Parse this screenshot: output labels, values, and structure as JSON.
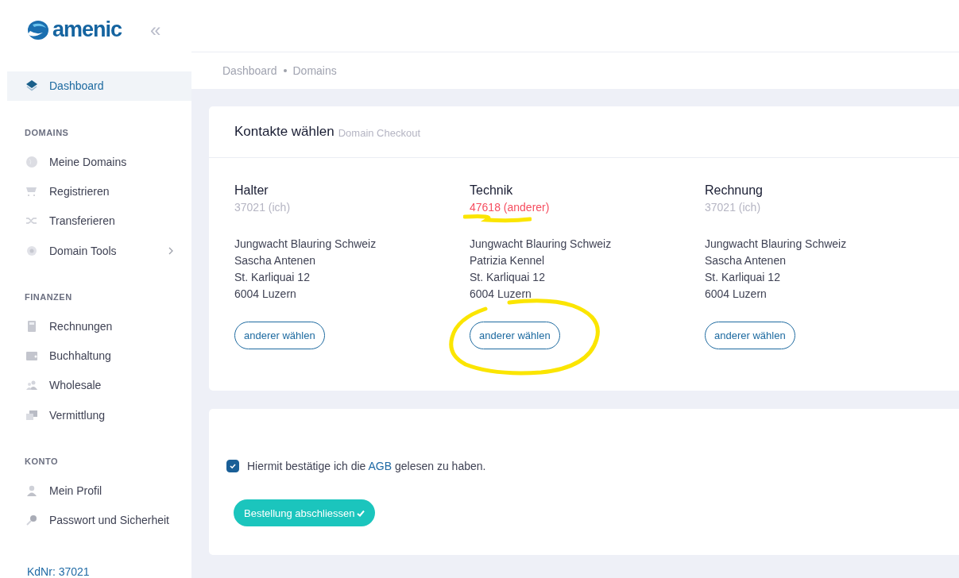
{
  "sidebar": {
    "brand": "amenic",
    "collapse_icon": "«",
    "items": [
      {
        "kind": "item",
        "label": "Dashboard",
        "selected": true
      },
      {
        "kind": "heading",
        "label": "DOMAINS"
      },
      {
        "kind": "item",
        "label": "Meine Domains",
        "selected": false
      },
      {
        "kind": "item",
        "label": "Registrieren",
        "selected": false
      },
      {
        "kind": "item",
        "label": "Transferieren",
        "selected": false
      },
      {
        "kind": "item",
        "label": "Domain Tools",
        "selected": false,
        "submenu": true
      },
      {
        "kind": "heading",
        "label": "FINANZEN"
      },
      {
        "kind": "item",
        "label": "Rechnungen",
        "selected": false
      },
      {
        "kind": "item",
        "label": "Buchhaltung",
        "selected": false
      },
      {
        "kind": "item",
        "label": "Wholesale",
        "selected": false
      },
      {
        "kind": "item",
        "label": "Vermittlung",
        "selected": false
      },
      {
        "kind": "heading",
        "label": "KONTO"
      },
      {
        "kind": "item",
        "label": "Mein Profil",
        "selected": false
      },
      {
        "kind": "item",
        "label": "Passwort und Sicherheit",
        "selected": false
      }
    ],
    "footer": "KdNr: 37021"
  },
  "breadcrumb": [
    "Dashboard",
    "Domains"
  ],
  "contacts_card": {
    "title": "Kontakte wählen",
    "subtitle": "Domain Checkout",
    "contacts": [
      {
        "role": "Halter",
        "id": "37021 (ich)",
        "other": false,
        "lines": [
          "Jungwacht Blauring Schweiz",
          "Sascha Antenen",
          "St. Karliquai 12",
          "6004 Luzern"
        ],
        "button": "anderer wählen"
      },
      {
        "role": "Technik",
        "id": "47618 (anderer)",
        "other": true,
        "lines": [
          "Jungwacht Blauring Schweiz",
          "Patrizia Kennel",
          "St. Karliquai 12",
          "6004 Luzern"
        ],
        "button": "anderer wählen",
        "underlined": true,
        "circled": true
      },
      {
        "role": "Rechnung",
        "id": "37021 (ich)",
        "other": false,
        "lines": [
          "Jungwacht Blauring Schweiz",
          "Sascha Antenen",
          "St. Karliquai 12",
          "6004 Luzern"
        ],
        "button": "anderer wählen"
      }
    ]
  },
  "order_card": {
    "agb": {
      "checked": true,
      "before": "Hiermit bestätige ich die",
      "link": "AGB",
      "after": "gelesen zu haben."
    },
    "submit": "Bestellung abschliessen"
  }
}
